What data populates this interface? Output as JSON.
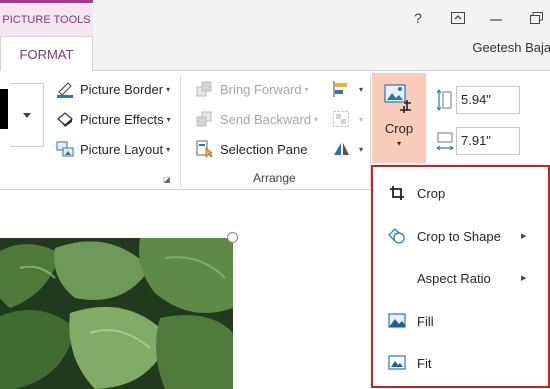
{
  "header": {
    "context_tab": "PICTURE TOOLS",
    "active_tab": "FORMAT",
    "help_glyph": "?",
    "user_name": "Geetesh Bajaj"
  },
  "picture_styles": {
    "picture_border": "Picture Border",
    "picture_effects": "Picture Effects",
    "picture_layout": "Picture Layout"
  },
  "arrange": {
    "bring_forward": "Bring Forward",
    "send_backward": "Send Backward",
    "selection_pane": "Selection Pane",
    "group_label": "Arrange"
  },
  "crop": {
    "label": "Crop",
    "height_value": "5.94\"",
    "width_value": "7.91\""
  },
  "crop_menu": {
    "items": [
      {
        "label": "Crop",
        "icon": "crop-icon",
        "has_submenu": false
      },
      {
        "label": "Crop to Shape",
        "icon": "crop-to-shape-icon",
        "has_submenu": true
      },
      {
        "label": "Aspect Ratio",
        "icon": "",
        "has_submenu": true
      },
      {
        "label": "Fill",
        "icon": "fill-icon",
        "has_submenu": false
      },
      {
        "label": "Fit",
        "icon": "fit-icon",
        "has_submenu": false
      }
    ]
  },
  "colors": {
    "accent_purple": "#80397b",
    "context_bg": "#f4e5f1",
    "crop_highlight": "#f7cdb9",
    "menu_border_red": "#d11c22"
  }
}
